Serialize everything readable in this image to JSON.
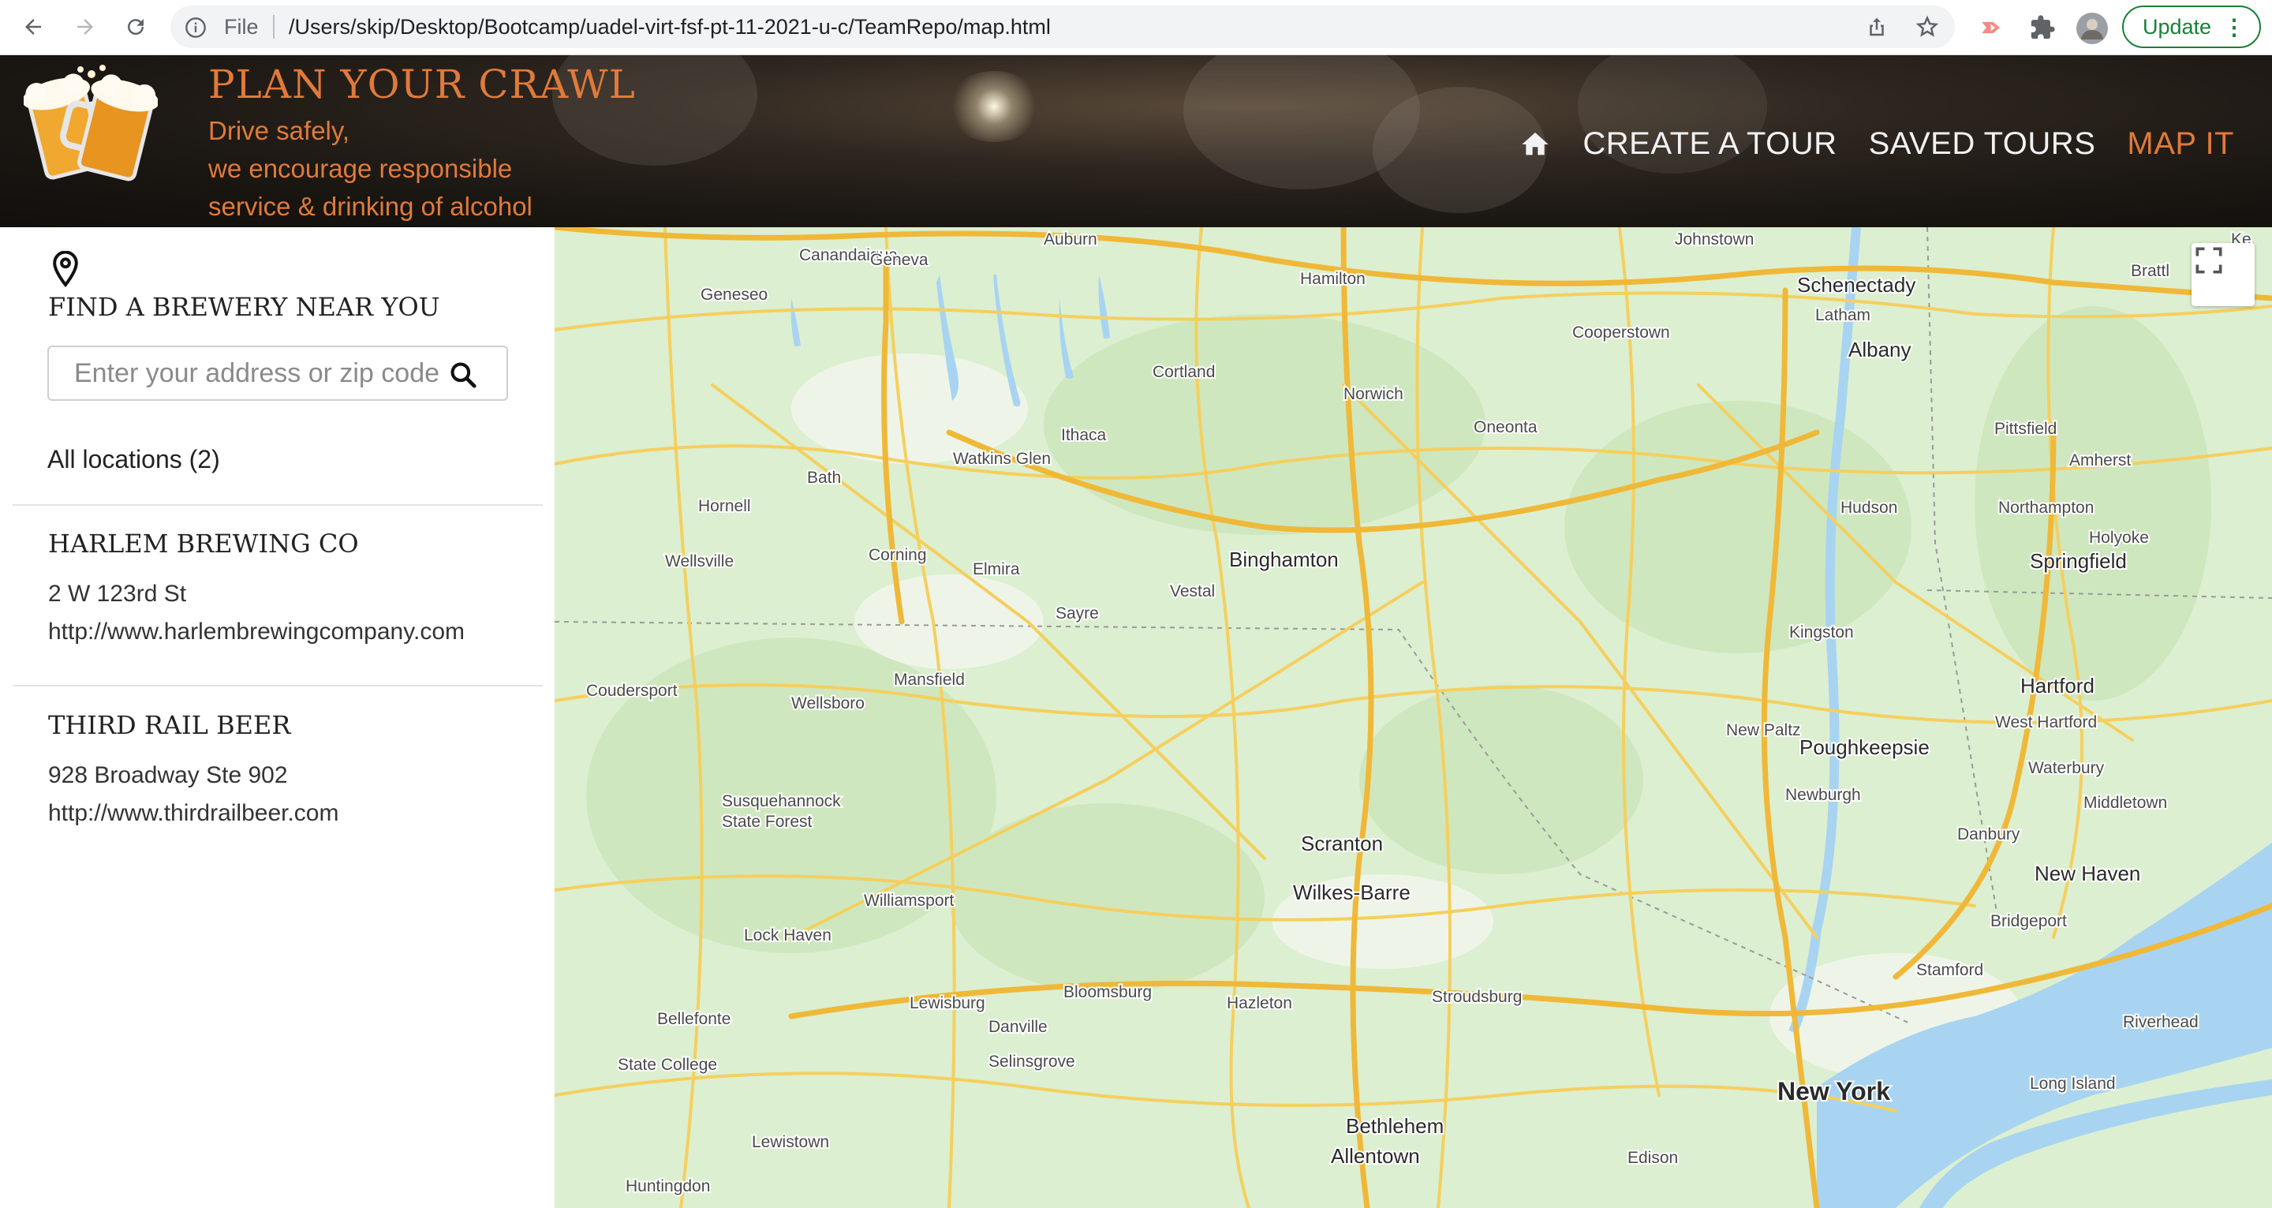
{
  "browser": {
    "file_label": "File",
    "url": "/Users/skip/Desktop/Bootcamp/uadel-virt-fsf-pt-11-2021-u-c/TeamRepo/map.html",
    "update_label": "Update"
  },
  "header": {
    "brand_title": "PLAN YOUR CRAWL",
    "tagline": [
      "Drive safely,",
      "we encourage responsible",
      "service & drinking of alcohol"
    ],
    "nav": {
      "home_icon": "home-icon",
      "links": [
        {
          "label": "CREATE A TOUR",
          "active": false
        },
        {
          "label": "SAVED TOURS",
          "active": false
        },
        {
          "label": "MAP IT",
          "active": true
        }
      ]
    },
    "accent_color": "#e07a3a"
  },
  "sidebar": {
    "title": "FIND A BREWERY NEAR YOU",
    "search_placeholder": "Enter your address or zip code",
    "all_locations": "All locations (2)",
    "locations": [
      {
        "name": "HARLEM BREWING CO",
        "address": "2 W 123rd St",
        "url": "http://www.harlembrewingcompany.com"
      },
      {
        "name": "THIRD RAIL BEER",
        "address": "928 Broadway Ste 902",
        "url": "http://www.thirdrailbeer.com"
      }
    ]
  },
  "map": {
    "places": [
      {
        "name": "Auburn"
      },
      {
        "name": "Canandaigua"
      },
      {
        "name": "Geneva"
      },
      {
        "name": "Geneseo"
      },
      {
        "name": "Johnstown"
      },
      {
        "name": "Schenectady"
      },
      {
        "name": "Latham"
      },
      {
        "name": "Albany"
      },
      {
        "name": "Hamilton"
      },
      {
        "name": "Cooperstown"
      },
      {
        "name": "Cortland"
      },
      {
        "name": "Norwich"
      },
      {
        "name": "Oneonta"
      },
      {
        "name": "Ithaca"
      },
      {
        "name": "Watkins Glen"
      },
      {
        "name": "Bath"
      },
      {
        "name": "Hornell"
      },
      {
        "name": "Pittsfield"
      },
      {
        "name": "Amherst"
      },
      {
        "name": "Northampton"
      },
      {
        "name": "Hudson"
      },
      {
        "name": "Holyoke"
      },
      {
        "name": "Springfield"
      },
      {
        "name": "Wellsville"
      },
      {
        "name": "Corning"
      },
      {
        "name": "Elmira"
      },
      {
        "name": "Binghamton"
      },
      {
        "name": "Vestal"
      },
      {
        "name": "Sayre"
      },
      {
        "name": "Kingston"
      },
      {
        "name": "Hartford"
      },
      {
        "name": "West Hartford"
      },
      {
        "name": "Coudersport"
      },
      {
        "name": "Wellsboro"
      },
      {
        "name": "Mansfield"
      },
      {
        "name": "New Paltz"
      },
      {
        "name": "Poughkeepsie"
      },
      {
        "name": "Waterbury"
      },
      {
        "name": "Middletown"
      },
      {
        "name": "Newburgh"
      },
      {
        "name": "Danbury"
      },
      {
        "name": "Susquehannock"
      },
      {
        "name": "State Forest"
      },
      {
        "name": "Scranton"
      },
      {
        "name": "New Haven"
      },
      {
        "name": "Wilkes-Barre"
      },
      {
        "name": "Williamsport"
      },
      {
        "name": "Bridgeport"
      },
      {
        "name": "Lock Haven"
      },
      {
        "name": "Stamford"
      },
      {
        "name": "Bloomsburg"
      },
      {
        "name": "Lewisburg"
      },
      {
        "name": "Hazleton"
      },
      {
        "name": "Stroudsburg"
      },
      {
        "name": "Bellefonte"
      },
      {
        "name": "Danville"
      },
      {
        "name": "Riverhead"
      },
      {
        "name": "State College"
      },
      {
        "name": "Selinsgrove"
      },
      {
        "name": "New York"
      },
      {
        "name": "Long Island"
      },
      {
        "name": "Bethlehem"
      },
      {
        "name": "Lewistown"
      },
      {
        "name": "Allentown"
      },
      {
        "name": "Edison"
      },
      {
        "name": "Huntingdon"
      },
      {
        "name": "Brattl"
      },
      {
        "name": "Ke"
      }
    ],
    "colors": {
      "land": "#dcefd0",
      "water": "#a8d4f2",
      "road": "#f5cf5e",
      "interstate": "#2d6fbf"
    }
  }
}
